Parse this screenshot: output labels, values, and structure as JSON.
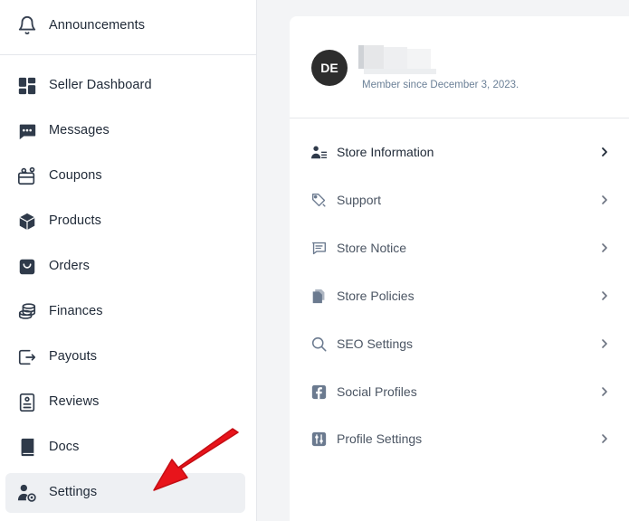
{
  "sidebar": {
    "announcements": "Announcements",
    "items": [
      {
        "label": "Seller Dashboard",
        "icon": "dashboard-icon"
      },
      {
        "label": "Messages",
        "icon": "messages-icon"
      },
      {
        "label": "Coupons",
        "icon": "coupon-icon"
      },
      {
        "label": "Products",
        "icon": "box-icon"
      },
      {
        "label": "Orders",
        "icon": "bag-icon"
      },
      {
        "label": "Finances",
        "icon": "coins-icon"
      },
      {
        "label": "Payouts",
        "icon": "payout-icon"
      },
      {
        "label": "Reviews",
        "icon": "reviews-icon"
      },
      {
        "label": "Docs",
        "icon": "book-icon"
      },
      {
        "label": "Settings",
        "icon": "user-gear-icon",
        "active": true
      }
    ]
  },
  "profile": {
    "initials": "DE",
    "member_since": "Member since December 3, 2023."
  },
  "settings_menu": [
    {
      "label": "Store Information",
      "icon": "store-info-icon"
    },
    {
      "label": "Support",
      "icon": "support-icon"
    },
    {
      "label": "Store Notice",
      "icon": "notice-icon"
    },
    {
      "label": "Store Policies",
      "icon": "policies-icon"
    },
    {
      "label": "SEO Settings",
      "icon": "search-icon"
    },
    {
      "label": "Social Profiles",
      "icon": "facebook-icon"
    },
    {
      "label": "Profile Settings",
      "icon": "sliders-icon"
    }
  ],
  "colors": {
    "active_item_bg": "#eef0f3",
    "annotation_arrow": "#e8141b",
    "avatar_bg": "#2d2d2d",
    "member_text": "#6b8097"
  }
}
